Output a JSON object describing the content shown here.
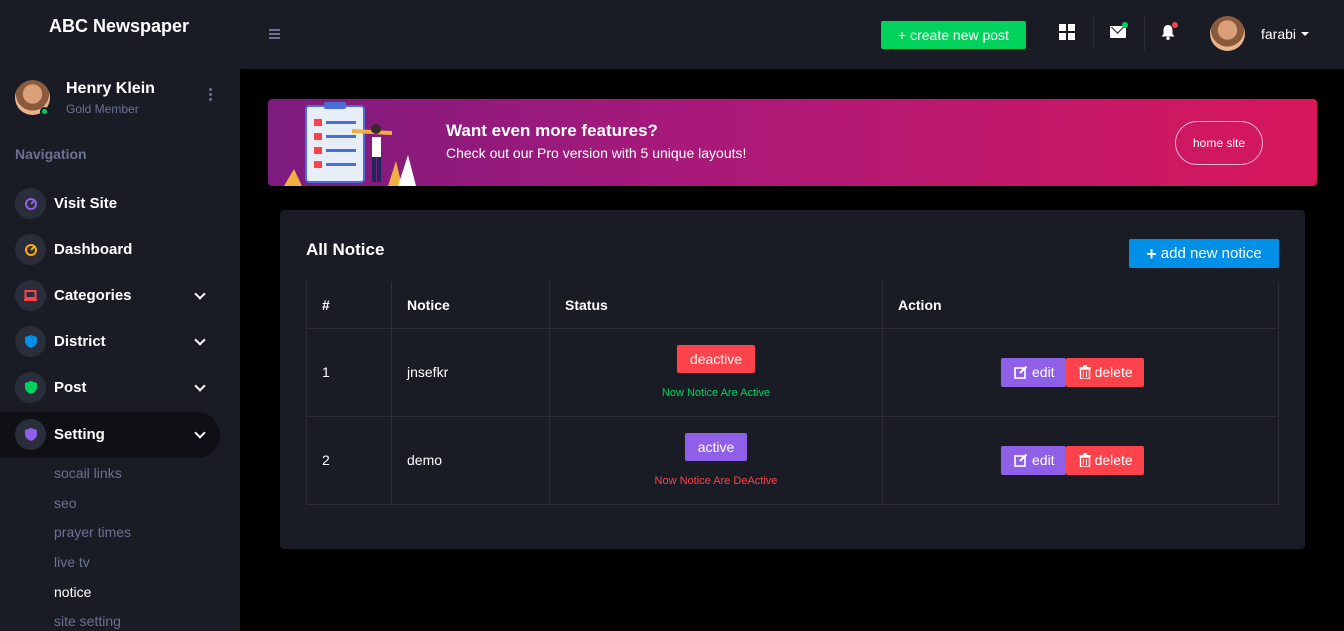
{
  "brand": "ABC Newspaper",
  "profile": {
    "name": "Henry Klein",
    "role": "Gold Member"
  },
  "nav_category": "Navigation",
  "menu": [
    {
      "label": "Visit Site",
      "icon": "speedometer-icon"
    },
    {
      "label": "Dashboard",
      "icon": "speedometer-icon"
    },
    {
      "label": "Categories",
      "icon": "laptop-icon"
    },
    {
      "label": "District",
      "icon": "shield-icon"
    },
    {
      "label": "Post",
      "icon": "shield-icon"
    },
    {
      "label": "Setting",
      "icon": "shield-icon"
    }
  ],
  "submenu": [
    "socail links",
    "seo",
    "prayer times",
    "live tv",
    "notice",
    "site setting"
  ],
  "topbar": {
    "create_label": "+ create new post",
    "user_name": "farabi"
  },
  "banner": {
    "title": "Want even more features?",
    "subtitle": "Check out our Pro version with 5 unique layouts!",
    "button": "home site"
  },
  "card": {
    "title": "All Notice",
    "add_label": "add new notice",
    "headers": [
      "#",
      "Notice",
      "Status",
      "Action"
    ],
    "rows": [
      {
        "num": "1",
        "notice": "jnsefkr",
        "status": "deactive",
        "note": "Now Notice Are Active",
        "edit": "edit",
        "delete": "delete"
      },
      {
        "num": "2",
        "notice": "demo",
        "status": "active",
        "note": "Now Notice Are DeActive",
        "edit": "edit",
        "delete": "delete"
      }
    ]
  },
  "colors": {
    "success": "#00d25b",
    "danger": "#fc424a",
    "primary": "#0090e7",
    "purple": "#8f5fe8",
    "sidebar": "#191c24"
  }
}
